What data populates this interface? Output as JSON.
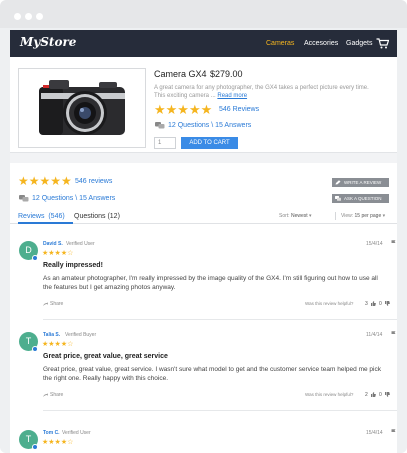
{
  "nav": {
    "logo": "MyStore",
    "items": [
      {
        "label": "Cameras",
        "active": true
      },
      {
        "label": "Accesories",
        "active": false
      },
      {
        "label": "Gadgets",
        "active": false
      }
    ]
  },
  "product": {
    "title": "Camera GX4",
    "price": "$279.00",
    "description": "A great camera for any photographer, the GX4 takes a perfect picture every time. This exciting camera ...",
    "read_more": "Read more",
    "stars": "★★★★★",
    "reviews_link": "546 Reviews",
    "qa_link": "12 Questions \\ 15 Answers",
    "quantity_value": "1",
    "add_to_cart": "ADD TO CART"
  },
  "summary": {
    "stars": "★★★★★",
    "reviews_link": "546 reviews",
    "qa_link": "12 Questions \\ 15 Answers",
    "write_review": "WRITE A REVIEW",
    "ask_question": "ASK A QUESTION"
  },
  "tabs": {
    "reviews_label": "Reviews",
    "reviews_count": "(546)",
    "questions_label": "Questions (12)",
    "sort_label": "Sort:",
    "sort_value": "Newest",
    "view_label": "View:",
    "view_value": "15 per page"
  },
  "reviews": [
    {
      "initial": "D",
      "name": "David S.",
      "badge": "Verified User",
      "stars": "★★★★☆",
      "date": "15/4/14",
      "title": "Really impressed!",
      "text": "As an amateur photographer, I'm really impressed by the image quality of the GX4. I'm still figuring out how to use all the features but I get amazing photos anyway.",
      "share": "Share",
      "helpful": "Was this review helpful?",
      "up": "3",
      "down": "0"
    },
    {
      "initial": "T",
      "name": "Talia S.",
      "badge": "Verified Buyer",
      "stars": "★★★★☆",
      "date": "11/4/14",
      "title": "Great price, great value, great service",
      "text": "Great price, great value, great service. I wasn't sure what model to get and the customer service team helped me pick the right one. Really happy with this choice.",
      "share": "Share",
      "helpful": "Was this review helpful?",
      "up": "2",
      "down": "0"
    },
    {
      "initial": "T",
      "name": "Tom C.",
      "badge": "Verified User",
      "stars": "★★★★☆",
      "date": "15/4/14"
    }
  ],
  "colors": {
    "navbar": "#262c3a",
    "accent_active": "#f5b51f",
    "link_blue": "#2a7ad6",
    "star_gold": "#f5b51f",
    "avatar_green": "#4dae8e"
  }
}
